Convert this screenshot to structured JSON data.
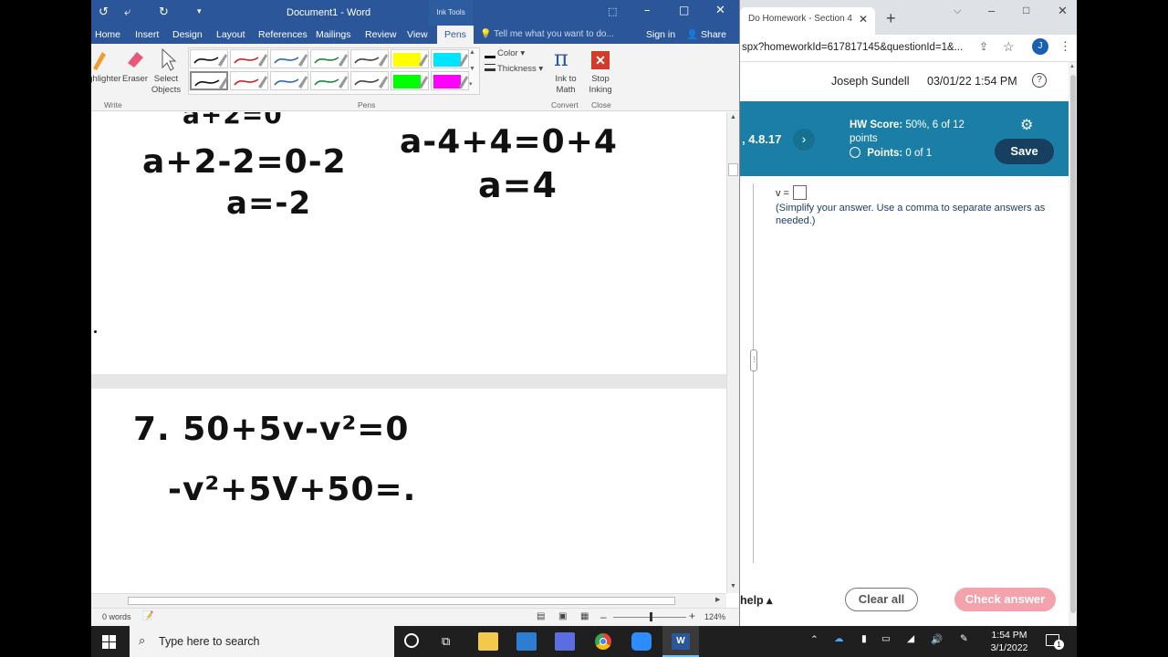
{
  "word": {
    "title": "Document1 - Word",
    "contextual_tab": "Ink Tools",
    "tabs": [
      "Home",
      "Insert",
      "Design",
      "Layout",
      "References",
      "Mailings",
      "Review",
      "View",
      "Pens"
    ],
    "active_tab": "Pens",
    "tell_me": "Tell me what you want to do...",
    "sign_in": "Sign in",
    "share": "Share",
    "ribbon": {
      "highlighter": "Highlighter",
      "eraser": "Eraser",
      "select_objects": "Select Objects",
      "color": "Color",
      "thickness": "Thickness",
      "ink_to_math": "Ink to Math",
      "stop_inking": "Stop Inking",
      "groups": {
        "write": "Write",
        "pens": "Pens",
        "convert": "Convert",
        "close": "Close"
      },
      "pen_colors_row1": [
        "#111111",
        "#d92020",
        "#2b6cb0",
        "#1f8a3a",
        "#444444",
        "#ffff00",
        "#00e5ff"
      ],
      "pen_colors_row2": [
        "#111111",
        "#d92020",
        "#2b6cb0",
        "#1f8a3a",
        "#444444",
        "#00ff00",
        "#ff00ff"
      ]
    },
    "ink": {
      "line1_left": "a+2-2=0-2",
      "line2_left": "a=-2",
      "line1_right": "a-4+4=0+4",
      "line2_right": "a=4",
      "problem_line1": "7.  50+5v-v²=0",
      "problem_line2": "-v²+5V+50=."
    },
    "status": {
      "words": "0 words",
      "zoom": "124%"
    }
  },
  "browser": {
    "tab_title": "Do Homework - Section 4",
    "url": "spx?homeworkId=617817145&questionId=1&...",
    "avatar": "J",
    "user_name": "Joseph Sundell",
    "datetime": "03/01/22 1:54 PM",
    "section": ", 4.8.17",
    "hw_score_label": "HW Score:",
    "hw_score_value": "50%, 6 of 12 points",
    "points_label": "Points:",
    "points_value": "0 of 1",
    "save": "Save",
    "answer_label": "v =",
    "instructions": "(Simplify your answer. Use a comma to separate answers as needed.)",
    "help": "help",
    "clear_all": "Clear all",
    "check_answer": "Check answer"
  },
  "taskbar": {
    "search_placeholder": "Type here to search",
    "time": "1:54 PM",
    "date": "3/1/2022",
    "notifications": "1"
  }
}
